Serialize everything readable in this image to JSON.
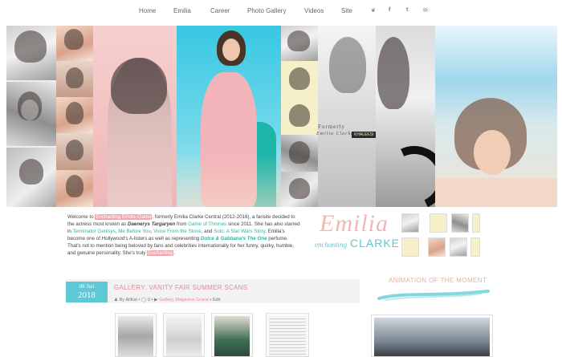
{
  "nav": {
    "items": [
      "Home",
      "Emilia",
      "Career",
      "Photo Gallery",
      "Videos",
      "Site"
    ],
    "icons": [
      "twitter-icon",
      "facebook-icon",
      "tumblr-icon",
      "email-icon"
    ],
    "icon_glyphs": [
      "❦",
      "f",
      "t",
      "✉"
    ]
  },
  "header": {
    "tag_formerly": "Formerly",
    "tag_name": "Emilia Clarke",
    "tag_label": "KHALEESI"
  },
  "intro": {
    "p1": "Welcome to ",
    "site_name": "Enchanting Emilia Clarke",
    "p2": ", formerly Emilia Clarke Central (2012-2016), a fansite decided to the actress most known as ",
    "daenerys": "Daenerys Targaryen",
    "p3": " from ",
    "got": "Game of Thrones",
    "p4": " since 2011. She has also starred in ",
    "terminator": "Terminator Genisys",
    "p5": ", ",
    "mebeforeyou": "Me Before You",
    "p6": ", ",
    "voice": "Voice From the Stone",
    "p7": ", and ",
    "solo": "Solo: A Star Wars Story",
    "p8": ". Emilia's become one of Hollywood's A-listers as well as representing ",
    "dg": "Dolce & Gabbana's The One",
    "p9": " perfume. That's not to mention being beloved by fans and celebrities internationally for her funny, quirky, humble, and genuine personality. She's truly ",
    "enchanting": "Enchanting",
    "p10": "."
  },
  "logo": {
    "emilia": "Emilia",
    "enchanting": "enchanting",
    "clarke": "CLARKE"
  },
  "post": {
    "date_day": "06 Jun",
    "date_year": "2018",
    "title": "GALLERY: VANITY FAIR SUMMER SCANS",
    "meta_by": "By AliKat",
    "meta_sep1": " • ",
    "comments_icon": "comment-icon",
    "comments": "0",
    "meta_sep2": " • ",
    "cat1": "Gallery",
    "meta_comma": ", ",
    "cat2": "Magazine Scans",
    "meta_sep3": " • ",
    "edit": "Edit"
  },
  "sidebar": {
    "title": "ANIMATION OF THE MOMENT"
  },
  "colors": {
    "accent_pink": "#e78896",
    "accent_teal": "#5ec8d6",
    "logo_pink": "#f2b7b0"
  }
}
